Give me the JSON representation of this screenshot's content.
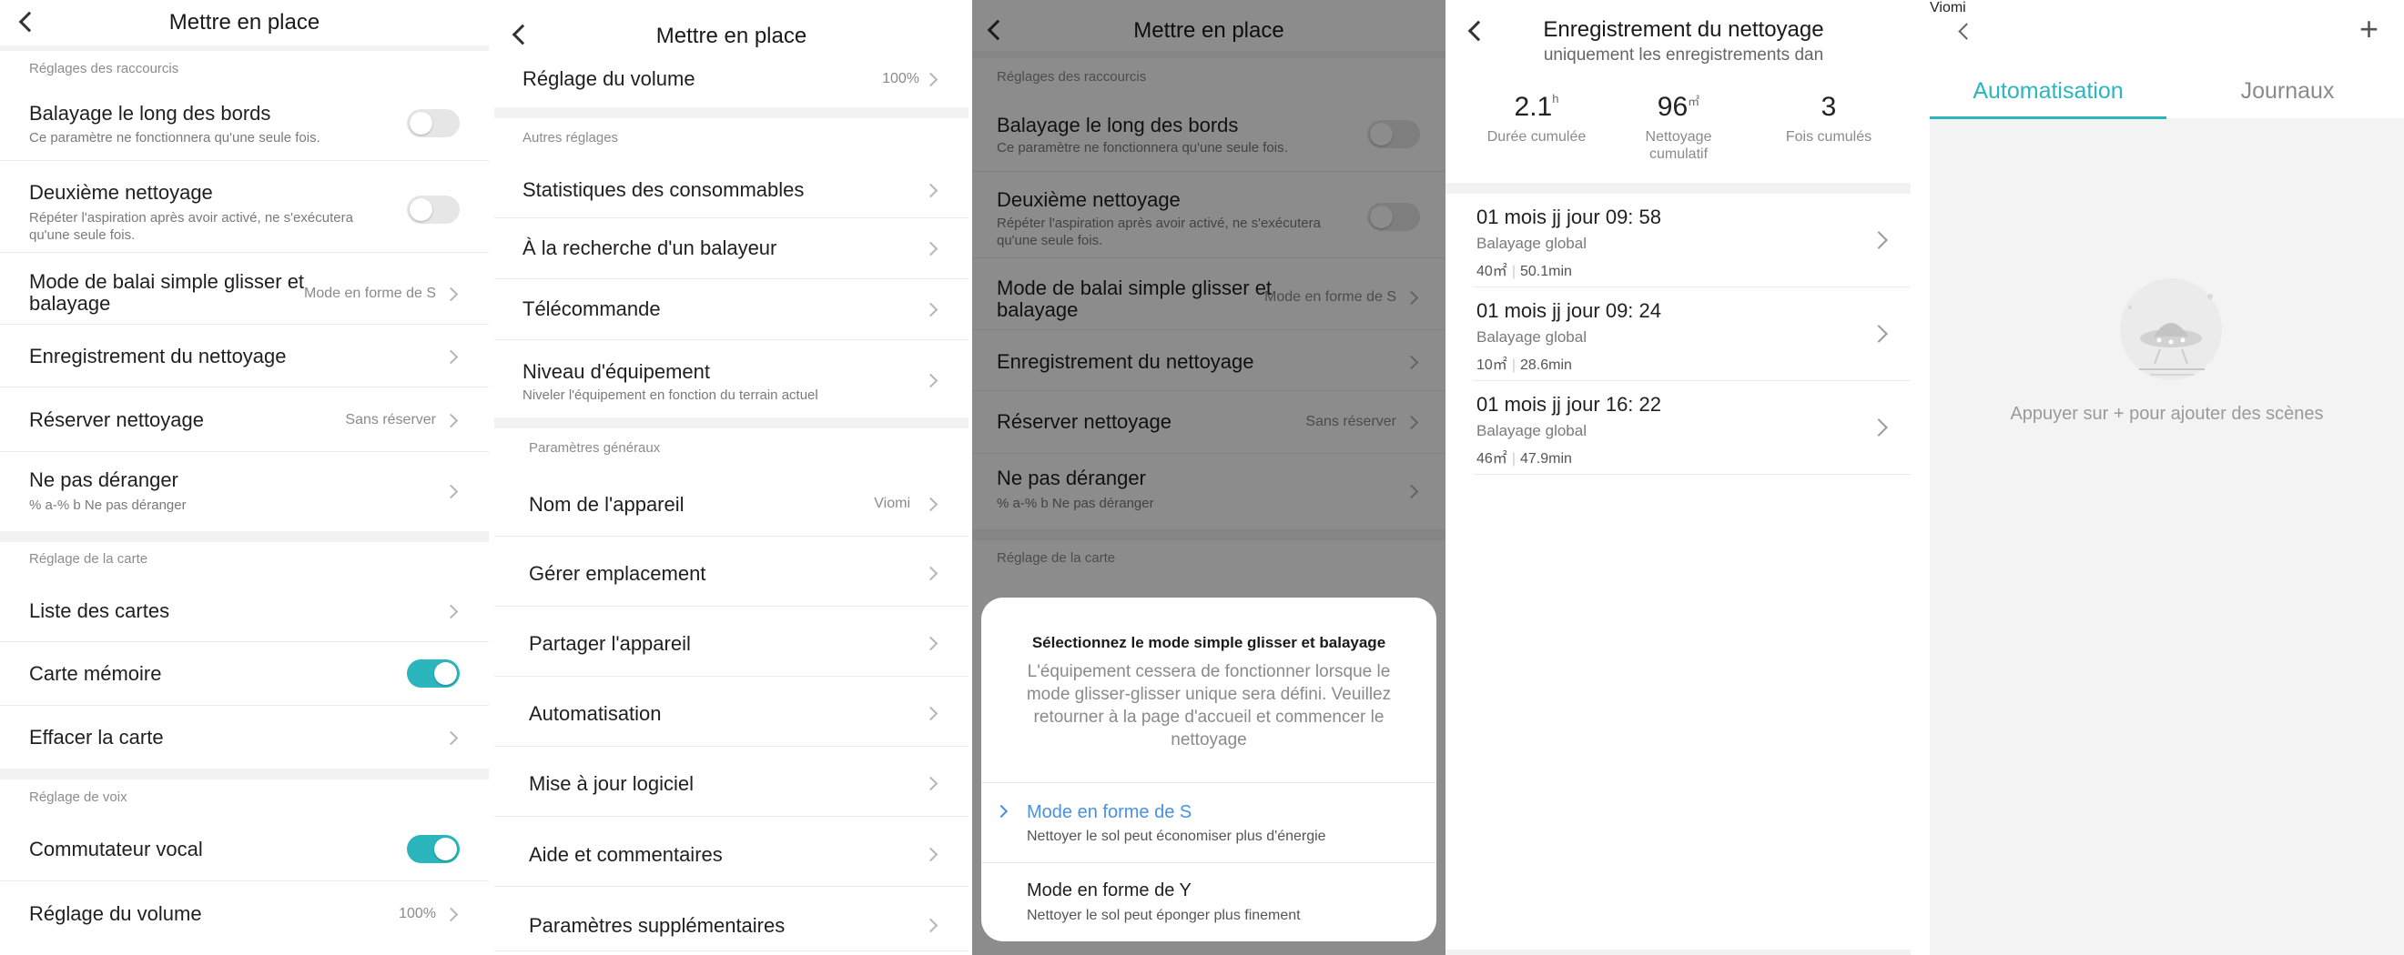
{
  "p1": {
    "title": "Mettre en place",
    "sec_shortcuts": "Réglages des raccourcis",
    "edge": {
      "label": "Balayage le long des bords",
      "sub": "Ce paramètre ne fonctionnera qu'une seule fois."
    },
    "second": {
      "label": "Deuxième nettoyage",
      "sub1": "Répéter l'aspiration après avoir activé, ne s'exécutera",
      "sub2": "qu'une seule fois."
    },
    "mode": {
      "label1": "Mode de balai simple glisser et",
      "label2": "balayage",
      "value": "Mode en forme de S"
    },
    "record": "Enregistrement du nettoyage",
    "reserve": {
      "label": "Réserver nettoyage",
      "value": "Sans réserver"
    },
    "dnd": {
      "label": "Ne pas déranger",
      "sub": "% a-% b Ne pas déranger"
    },
    "sec_map": "Réglage de la carte",
    "map_list": "Liste des cartes",
    "map_memory": "Carte mémoire",
    "map_clear": "Effacer la carte",
    "sec_voice": "Réglage de voix",
    "voice_switch": "Commutateur vocal",
    "volume": {
      "label": "Réglage du volume",
      "value": "100%"
    }
  },
  "p2": {
    "title": "Mettre en place",
    "volume": {
      "label": "Réglage du volume",
      "value": "100%"
    },
    "sec_other": "Autres réglages",
    "consumables": "Statistiques des consommables",
    "search": "À la recherche d'un balayeur",
    "remote": "Télécommande",
    "level": {
      "label": "Niveau d'équipement",
      "sub": "Niveler l'équipement en fonction du terrain actuel"
    },
    "sec_general": "Paramètres généraux",
    "device_name": {
      "label": "Nom de l'appareil",
      "value": "Viomi"
    },
    "location": "Gérer emplacement",
    "share": "Partager l'appareil",
    "automation": "Automatisation",
    "update": "Mise à jour logiciel",
    "help": "Aide et commentaires",
    "more": "Paramètres supplémentaires"
  },
  "p3": {
    "title": "Mettre en place",
    "sec_shortcuts": "Réglages des raccourcis",
    "edge": {
      "label": "Balayage le long des bords",
      "sub": "Ce paramètre ne fonctionnera qu'une seule fois."
    },
    "second": {
      "label": "Deuxième nettoyage",
      "sub1": "Répéter l'aspiration après avoir activé, ne s'exécutera",
      "sub2": "qu'une seule fois."
    },
    "mode": {
      "label1": "Mode de balai simple glisser et",
      "label2": "balayage",
      "value": "Mode en forme de S"
    },
    "record": "Enregistrement du nettoyage",
    "reserve": {
      "label": "Réserver nettoyage",
      "value": "Sans réserver"
    },
    "dnd": {
      "label": "Ne pas déranger",
      "sub": "% a-% b Ne pas déranger"
    },
    "sec_map": "Réglage de la carte",
    "dialog": {
      "title": "Sélectionnez  le mode simple glisser et balayage",
      "desc1": "L'équipement cessera de fonctionner lorsque le",
      "desc2": "mode glisser-glisser unique sera défini. Veuillez",
      "desc3": "retourner à la page d'accueil et commencer le",
      "desc4": "nettoyage",
      "opt_s": {
        "label": "Mode en forme de S",
        "sub": "Nettoyer le sol peut économiser plus d'énergie"
      },
      "opt_y": {
        "label": "Mode en forme de Y",
        "sub": "Nettoyer le sol peut éponger plus finement"
      }
    }
  },
  "p4": {
    "title": "Enregistrement du nettoyage",
    "subtitle": "uniquement les enregistrements dan",
    "stats": [
      {
        "value": "2.1",
        "unit": "h",
        "label1": "Durée cumulée",
        "label2": ""
      },
      {
        "value": "96",
        "unit": "㎡",
        "label1": "Nettoyage",
        "label2": "cumulatif"
      },
      {
        "value": "3",
        "unit": "",
        "label1": "Fois cumulés",
        "label2": ""
      }
    ],
    "records": [
      {
        "date": "01 mois jj jour 09: 58",
        "type": "Balayage global",
        "area": "40㎡",
        "time": "50.1min"
      },
      {
        "date": "01 mois jj jour 09: 24",
        "type": "Balayage global",
        "area": "10㎡",
        "time": "28.6min"
      },
      {
        "date": "01 mois jj jour 16: 22",
        "type": "Balayage global",
        "area": "46㎡",
        "time": "47.9min"
      }
    ]
  },
  "p5": {
    "title": "Viomi",
    "tab_auto": "Automatisation",
    "tab_logs": "Journaux",
    "empty": "Appuyer sur + pour ajouter des scènes",
    "accent": "#2bb5bd"
  }
}
